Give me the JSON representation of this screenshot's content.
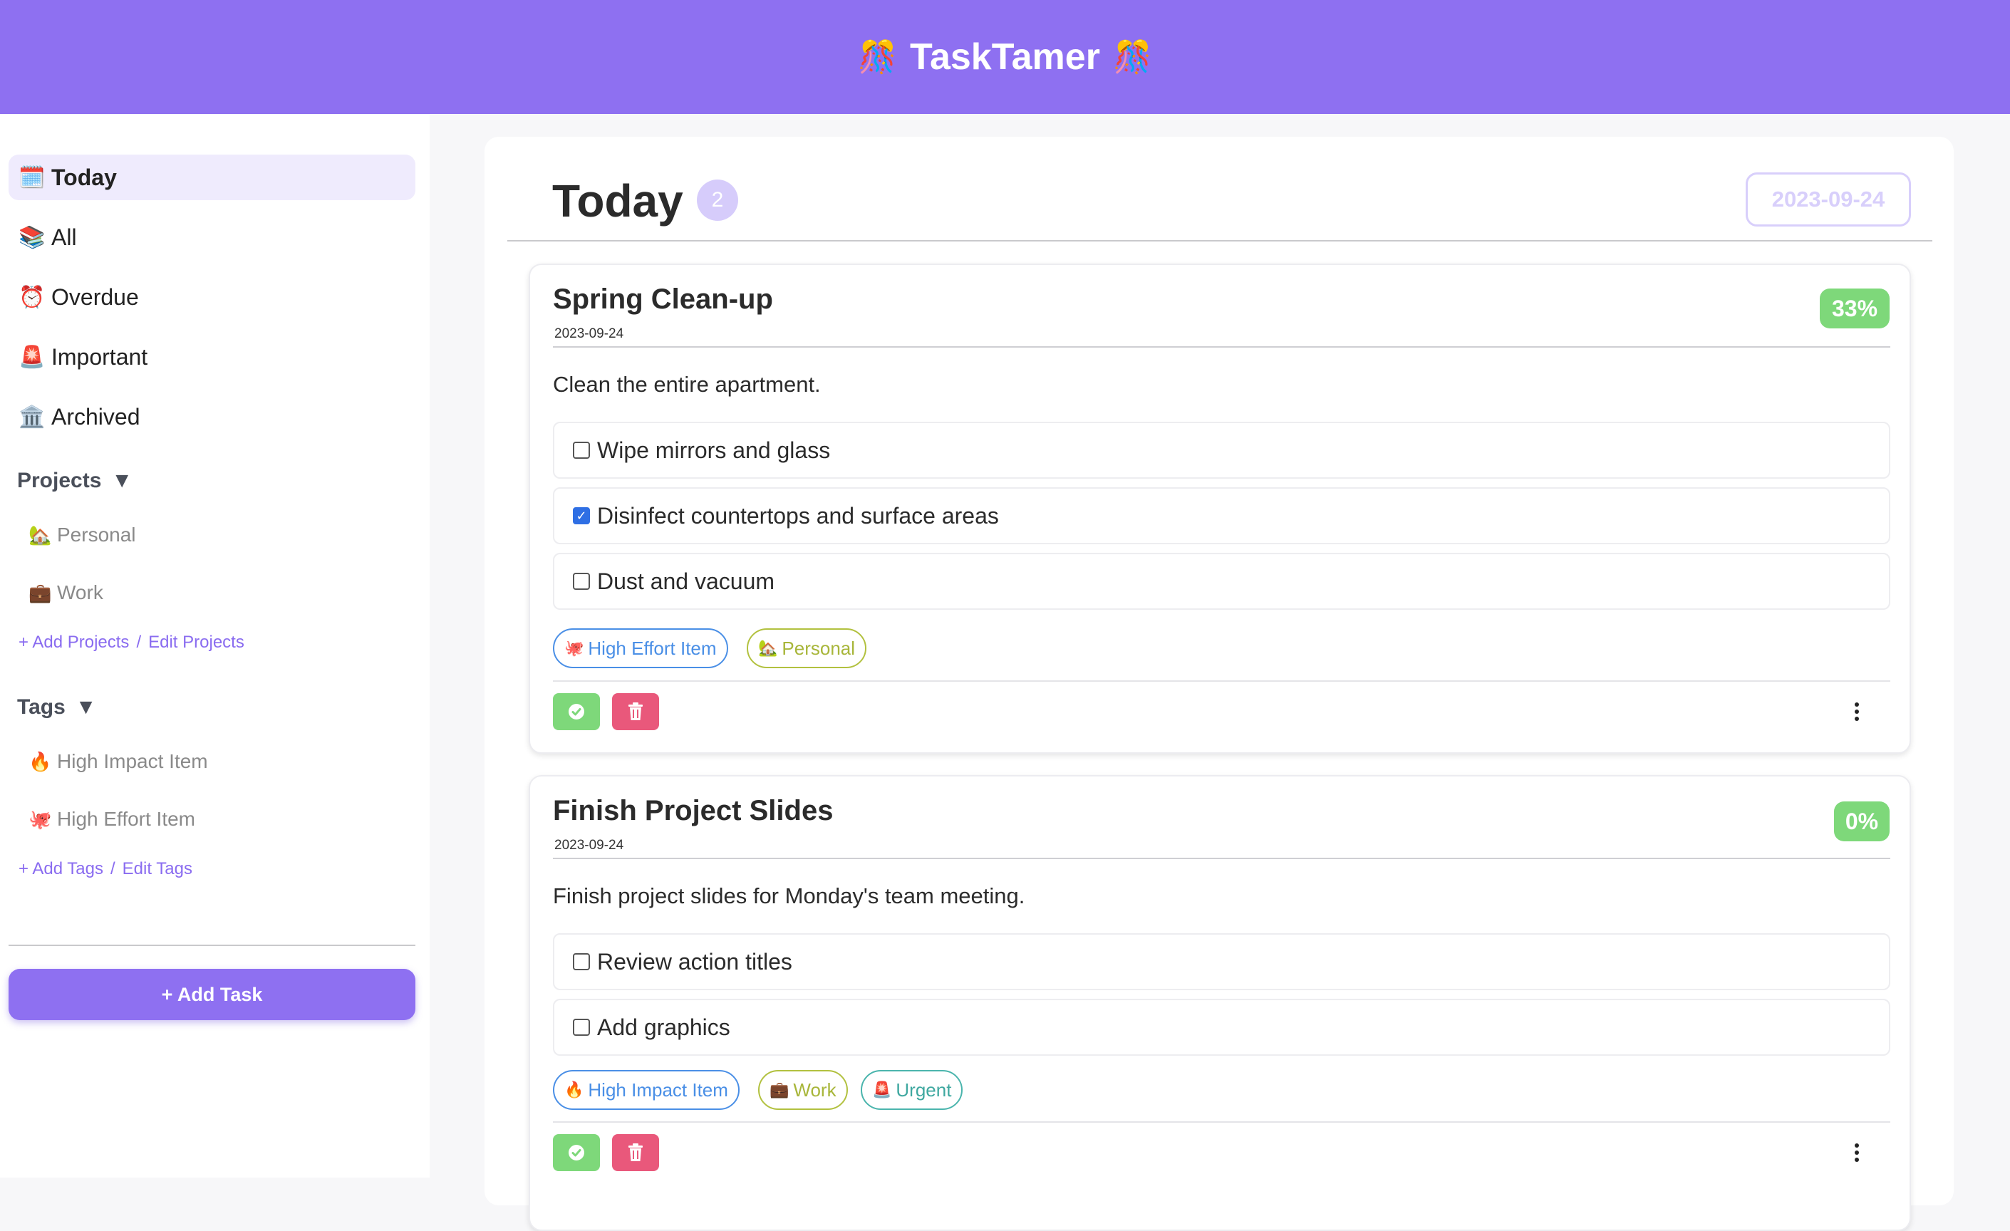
{
  "app": {
    "title": "TaskTamer",
    "title_icon": "sparkle-icon"
  },
  "sidebar": {
    "nav": [
      {
        "label": "Today",
        "icon": "🗓️",
        "icon_name": "calendar-icon",
        "active": true
      },
      {
        "label": "All",
        "icon": "📚",
        "icon_name": "books-icon",
        "active": false
      },
      {
        "label": "Overdue",
        "icon": "⏰",
        "icon_name": "alarm-clock-icon",
        "active": false
      },
      {
        "label": "Important",
        "icon": "🚨",
        "icon_name": "siren-icon",
        "active": false
      },
      {
        "label": "Archived",
        "icon": "🏛️",
        "icon_name": "archive-building-icon",
        "active": false
      }
    ],
    "projects": {
      "heading": "Projects",
      "caret": "▼",
      "items": [
        {
          "label": "Personal",
          "icon": "🏡"
        },
        {
          "label": "Work",
          "icon": "💼"
        }
      ],
      "add_link": "+ Add Projects",
      "separator": "/",
      "edit_link": "Edit Projects"
    },
    "tags": {
      "heading": "Tags",
      "caret": "▼",
      "items": [
        {
          "label": "High Impact Item",
          "icon": "🔥"
        },
        {
          "label": "High Effort Item",
          "icon": "🐙"
        }
      ],
      "add_link": "+ Add Tags",
      "separator": "/",
      "edit_link": "Edit Tags"
    },
    "add_task_label": "+ Add Task"
  },
  "main": {
    "title": "Today",
    "count": "2",
    "date": "2023-09-24",
    "tasks": [
      {
        "title": "Spring Clean-up",
        "date": "2023-09-24",
        "progress": "33%",
        "description": "Clean the entire apartment.",
        "subtasks": [
          {
            "label": "Wipe mirrors and glass",
            "checked": false
          },
          {
            "label": "Disinfect countertops and surface areas",
            "checked": true
          },
          {
            "label": "Dust and vacuum",
            "checked": false
          }
        ],
        "tags": [
          {
            "label": "High Effort Item",
            "icon": "🐙",
            "color": "#4a8fe6"
          },
          {
            "label": "Personal",
            "icon": "🏡",
            "color": "#a8b63a"
          }
        ]
      },
      {
        "title": "Finish Project Slides",
        "date": "2023-09-24",
        "progress": "0%",
        "description": "Finish project slides for Monday's team meeting.",
        "subtasks": [
          {
            "label": "Review action titles",
            "checked": false
          },
          {
            "label": "Add graphics",
            "checked": false
          }
        ],
        "tags": [
          {
            "label": "High Impact Item",
            "icon": "🔥",
            "color": "#4a8fe6"
          },
          {
            "label": "Work",
            "icon": "💼",
            "color": "#a8b63a"
          },
          {
            "label": "Urgent",
            "icon": "🚨",
            "color": "#3fa8a0"
          }
        ]
      }
    ]
  },
  "colors": {
    "accent": "#8e70f1",
    "success": "#7ed87a",
    "danger": "#e9587b"
  }
}
